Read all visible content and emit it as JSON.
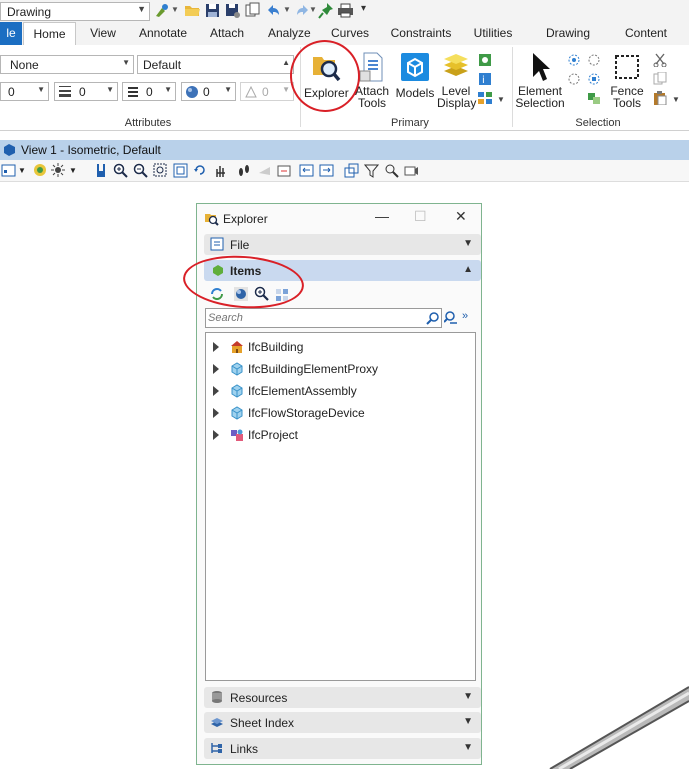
{
  "quick_access": {
    "workspace": "Drawing"
  },
  "tabs": [
    "le",
    "Home",
    "View",
    "Annotate",
    "Attach",
    "Analyze",
    "Curves",
    "Constraints",
    "Utilities",
    "Drawing Aids",
    "Content"
  ],
  "attributes": {
    "level": "None",
    "style": "Default",
    "color": "0",
    "weight": "0",
    "linestyle": "0",
    "transparency": "0",
    "priority": "0",
    "group_label": "Attributes"
  },
  "primary": {
    "explorer": "Explorer",
    "attach_tools_1": "Attach",
    "attach_tools_2": "Tools",
    "models": "Models",
    "level_display_1": "Level",
    "level_display_2": "Display",
    "group_label": "Primary"
  },
  "selection": {
    "element_selection_1": "Element",
    "element_selection_2": "Selection",
    "fence_tools_1": "Fence",
    "fence_tools_2": "Tools",
    "group_label": "Selection"
  },
  "view": {
    "title": "View 1 - Isometric, Default"
  },
  "explorer": {
    "title": "Explorer",
    "sections": {
      "file": "File",
      "items": "Items",
      "resources": "Resources",
      "sheet_index": "Sheet Index",
      "links": "Links"
    },
    "search_placeholder": "Search",
    "tree": [
      {
        "label": "IfcBuilding",
        "icon": "building-icon"
      },
      {
        "label": "IfcBuildingElementProxy",
        "icon": "cube-icon"
      },
      {
        "label": "IfcElementAssembly",
        "icon": "cube-icon"
      },
      {
        "label": "IfcFlowStorageDevice",
        "icon": "cube-icon"
      },
      {
        "label": "IfcProject",
        "icon": "project-icon"
      }
    ]
  },
  "colors": {
    "accent": "#1b6ec2",
    "view_bar": "#b9d1ea",
    "items_header": "#c9d9ef",
    "annotation": "#d92027"
  }
}
